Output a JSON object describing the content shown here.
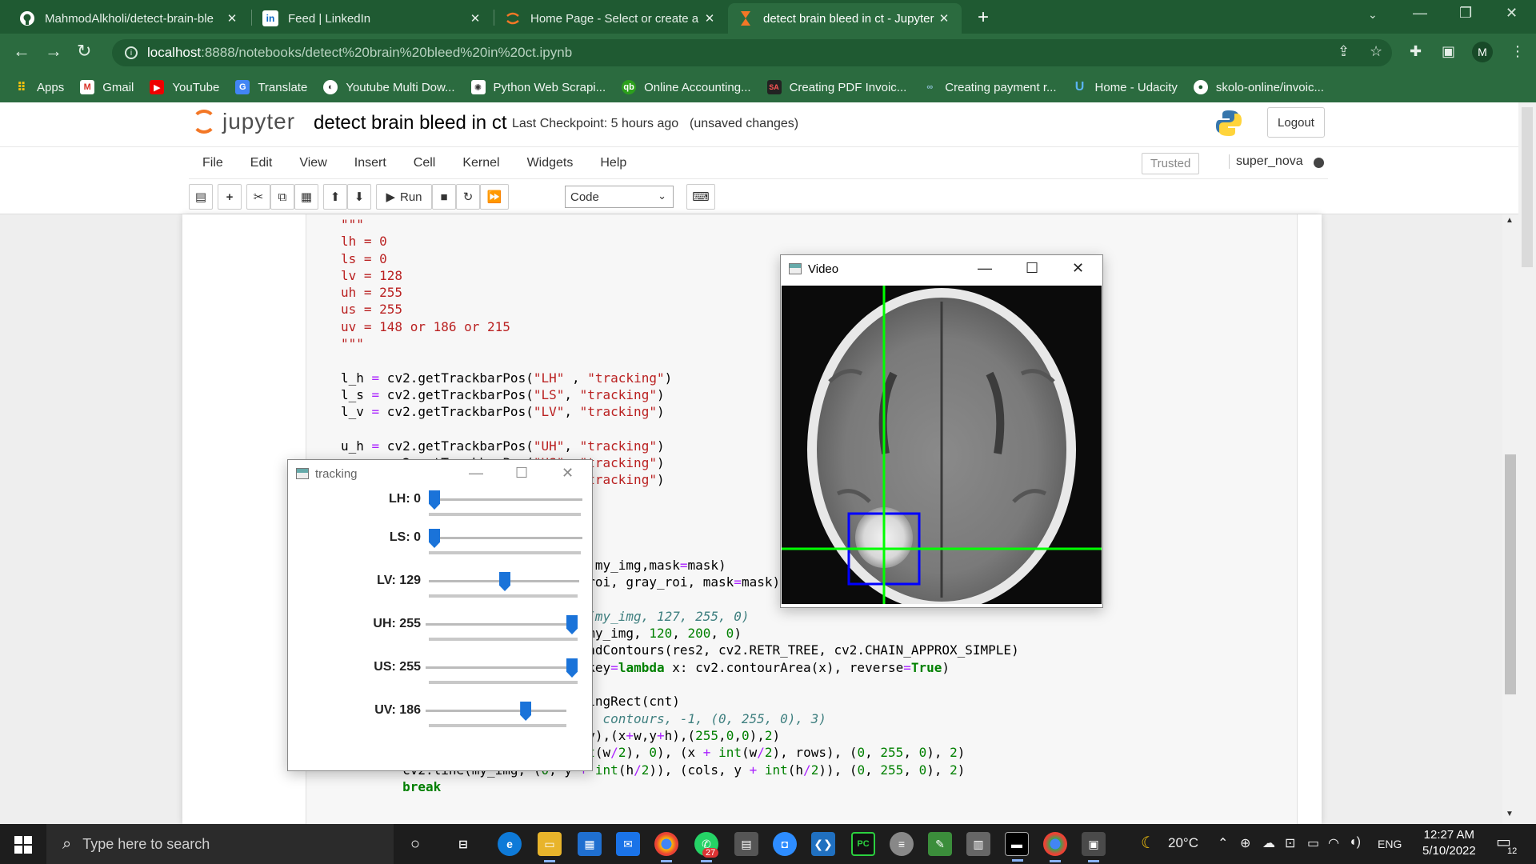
{
  "browser": {
    "tabs": [
      {
        "title": "MahmodAlkholi/detect-brain-ble",
        "icon": "github-icon"
      },
      {
        "title": "Feed | LinkedIn",
        "icon": "linkedin-icon"
      },
      {
        "title": "Home Page - Select or create a n",
        "icon": "jupyter-icon"
      },
      {
        "title": "detect brain bleed in ct - Jupyter",
        "icon": "hourglass-icon"
      }
    ],
    "url_host": "localhost",
    "url_path": ":8888/notebooks/detect%20brain%20bleed%20in%20ct.ipynb",
    "profile_initial": "M",
    "bookmarks": [
      "Apps",
      "Gmail",
      "YouTube",
      "Translate",
      "Youtube Multi Dow...",
      "Python Web Scrapi...",
      "Online Accounting...",
      "Creating PDF Invoic...",
      "Creating payment r...",
      "Home - Udacity",
      "skolo-online/invoic..."
    ]
  },
  "jupyter": {
    "logo_text": "jupyter",
    "notebook_name": "detect brain bleed in ct",
    "checkpoint": "Last Checkpoint: 5 hours ago",
    "unsaved": "(unsaved changes)",
    "logout": "Logout",
    "menu": [
      "File",
      "Edit",
      "View",
      "Insert",
      "Cell",
      "Kernel",
      "Widgets",
      "Help"
    ],
    "trusted": "Trusted",
    "kernel": "super_nova",
    "run_label": "Run",
    "cell_type": "Code"
  },
  "tracking_window": {
    "title": "tracking",
    "sliders": [
      {
        "label": "LH: 0",
        "value": 0,
        "max": 255
      },
      {
        "label": "LS: 0",
        "value": 0,
        "max": 255
      },
      {
        "label": "LV: 129",
        "value": 129,
        "max": 255
      },
      {
        "label": "UH: 255",
        "value": 255,
        "max": 255
      },
      {
        "label": "US: 255",
        "value": 255,
        "max": 255
      },
      {
        "label": "UV: 186",
        "value": 186,
        "max": 255
      }
    ]
  },
  "video_window": {
    "title": "Video"
  },
  "taskbar": {
    "search_placeholder": "Type here to search",
    "weather": "20°C",
    "language": "ENG",
    "time": "12:27 AM",
    "date": "5/10/2022",
    "whatsapp_badge": "27",
    "notification_count": "12"
  }
}
